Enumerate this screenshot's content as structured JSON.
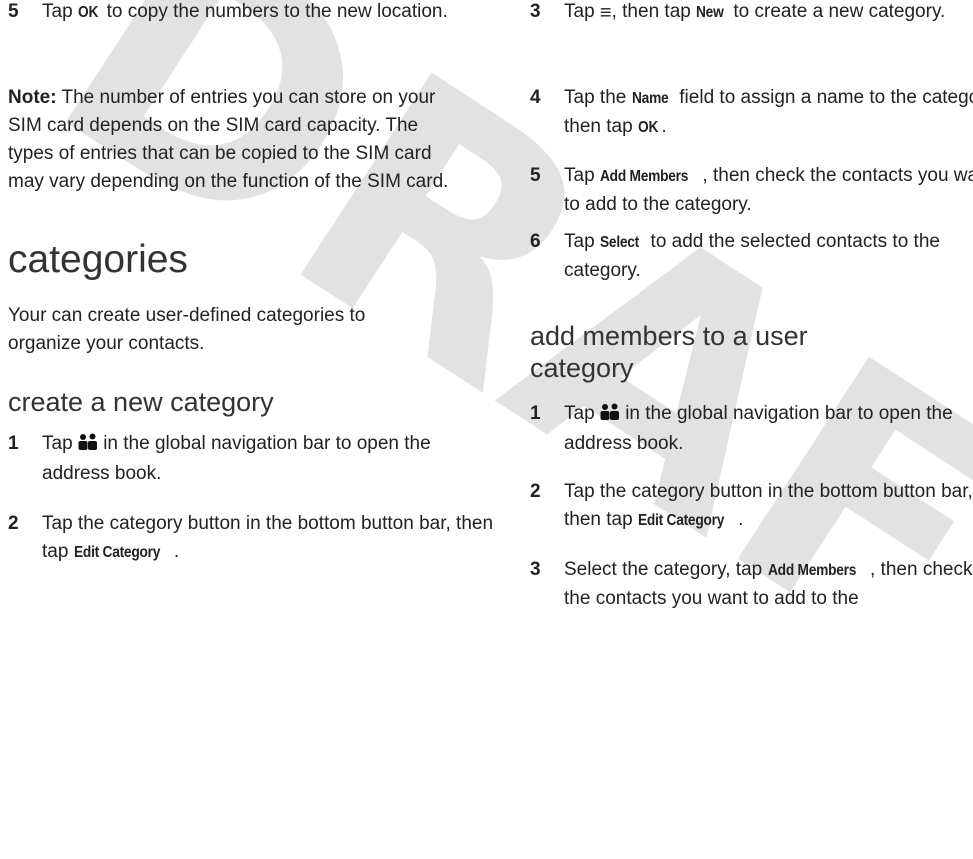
{
  "watermark": "DRAFT",
  "left": {
    "step5": {
      "num": "5",
      "pre": "Tap ",
      "kw": "OK",
      "post": " to copy the numbers to the new location."
    },
    "note": {
      "label": "Note:",
      "text": " The number of entries you can store on your SIM card depends on the SIM card capacity. The types of entries that can be copied to the SIM card may vary depending on the function of the SIM card."
    },
    "title": "categories",
    "intro": "Your can create user-defined categories to organize your contacts.",
    "subtitle": "create a new category",
    "step1": {
      "num": "1",
      "pre": "Tap ",
      "post": " in the global navigation bar to open the address book."
    },
    "step2": {
      "num": "2",
      "pre": "Tap the category button in the bottom button bar, then tap ",
      "kw": "Edit Category",
      "post": "."
    }
  },
  "right": {
    "step3": {
      "num": "3",
      "pre": "Tap ",
      "mid": ", then tap ",
      "kw": "New",
      "post": " to create a new category."
    },
    "step4": {
      "num": "4",
      "pre": "Tap the ",
      "kw": "Name",
      "mid": " field to assign a name to the category, then tap ",
      "kw2": "OK",
      "post": "."
    },
    "step5": {
      "num": "5",
      "pre": "Tap ",
      "kw": "Add Members",
      "post": ", then check the contacts you want to add to the category."
    },
    "step6": {
      "num": "6",
      "pre": "Tap ",
      "kw": "Select",
      "post": " to add the selected contacts to the category."
    },
    "subtitle": "add members to a user category",
    "a1": {
      "num": "1",
      "pre": "Tap ",
      "post": " in the global navigation bar to open the address book."
    },
    "a2": {
      "num": "2",
      "pre": "Tap the category button in the bottom button bar, then tap ",
      "kw": "Edit Category",
      "post": "."
    },
    "a3": {
      "num": "3",
      "pre": "Select the category, tap ",
      "kw": "Add Members",
      "post": ", then check the contacts you want to add to the"
    }
  },
  "icons": {
    "contacts": "contacts-icon",
    "menu": "menu-icon"
  }
}
